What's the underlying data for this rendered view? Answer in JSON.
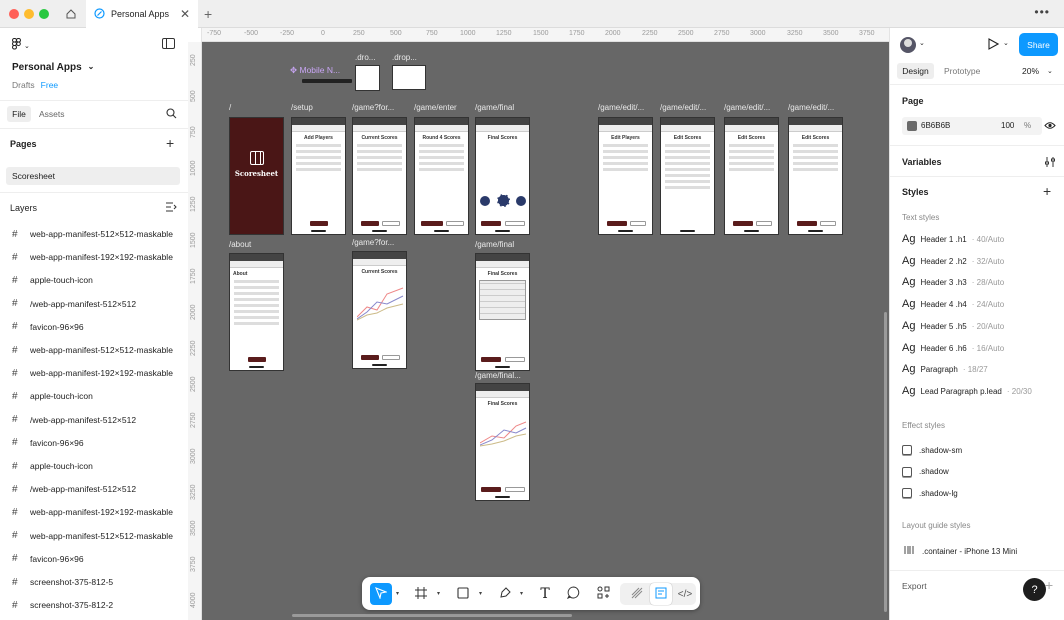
{
  "window": {
    "tab_title": "Personal Apps"
  },
  "file": {
    "name": "Personal Apps",
    "location": "Drafts",
    "plan": "Free",
    "tabs": [
      "File",
      "Assets"
    ]
  },
  "pages": {
    "title": "Pages",
    "items": [
      "Scoresheet"
    ]
  },
  "layers": {
    "title": "Layers",
    "items": [
      "web-app-manifest-512×512-maskable",
      "web-app-manifest-192×192-maskable",
      "apple-touch-icon",
      "/web-app-manifest-512×512",
      "favicon-96×96",
      "web-app-manifest-512×512-maskable",
      "web-app-manifest-192×192-maskable",
      "apple-touch-icon",
      "/web-app-manifest-512×512",
      "favicon-96×96",
      "apple-touch-icon",
      "/web-app-manifest-512×512",
      "web-app-manifest-192×192-maskable",
      "web-app-manifest-512×512-maskable",
      "favicon-96×96",
      "screenshot-375-812-5",
      "screenshot-375-812-2"
    ]
  },
  "rulers": {
    "h": [
      "-750",
      "-500",
      "-250",
      "0",
      "250",
      "500",
      "750",
      "1000",
      "1250",
      "1500",
      "1750",
      "2000",
      "2250",
      "2500",
      "2750",
      "3000",
      "3250",
      "3500",
      "3750"
    ],
    "v": [
      "250",
      "500",
      "750",
      "1000",
      "1250",
      "1500",
      "1750",
      "2000",
      "2250",
      "2500",
      "2750",
      "3000",
      "3250",
      "3500",
      "3750",
      "4000"
    ]
  },
  "canvas": {
    "labels": {
      "mobile": "Mobile N...",
      "drop1": ".dro...",
      "drop2": ".drop...",
      "root": "/",
      "setup": "/setup",
      "gamefor": "/game?for...",
      "gameenter": "/game/enter",
      "gamefinal": "/game/final",
      "edit1": "/game/edit/...",
      "edit2": "/game/edit/...",
      "edit3": "/game/edit/...",
      "edit4": "/game/edit/...",
      "about": "/about",
      "gamefor2": "/game?for...",
      "gamefinal2": "/game/final",
      "gamefinal3": "/game/final..."
    },
    "frames": {
      "splash": "Scoresheet",
      "add_players": "Add Players",
      "current_scores": "Current Scores",
      "round_scores": "Round 4 Scores",
      "final_scores": "Final Scores",
      "edit_players": "Edit Players",
      "edit_scores": "Edit Scores",
      "about": "About"
    }
  },
  "inspector": {
    "tabs": [
      "Design",
      "Prototype"
    ],
    "zoom": "20%",
    "share": "Share",
    "page": {
      "title": "Page",
      "color_hex": "6B6B6B",
      "opacity": "100",
      "percent": "%",
      "swatch": "#6b6b6b"
    },
    "variables": "Variables",
    "styles": "Styles",
    "text_styles_title": "Text styles",
    "text_styles": [
      {
        "ag": "Ag",
        "name": "Header 1 .h1",
        "meta": "· 40/Auto"
      },
      {
        "ag": "Ag",
        "name": "Header 2 .h2",
        "meta": "· 32/Auto"
      },
      {
        "ag": "Ag",
        "name": "Header 3 .h3",
        "meta": "· 28/Auto"
      },
      {
        "ag": "Ag",
        "name": "Header 4 .h4",
        "meta": "· 24/Auto"
      },
      {
        "ag": "Ag",
        "name": "Header 5 .h5",
        "meta": "· 20/Auto"
      },
      {
        "ag": "Ag",
        "name": "Header 6 .h6",
        "meta": "· 16/Auto"
      },
      {
        "ag": "Ag",
        "name": "Paragraph",
        "meta": "· 18/27"
      },
      {
        "ag": "Ag",
        "name": "Lead Paragraph p.lead",
        "meta": "· 20/30"
      }
    ],
    "effect_styles_title": "Effect styles",
    "effect_styles": [
      ".shadow-sm",
      ".shadow",
      ".shadow-lg"
    ],
    "layout_styles_title": "Layout guide styles",
    "layout_styles": [
      ".container - iPhone 13 Mini"
    ],
    "export": "Export",
    "help": "?"
  },
  "colors": {
    "canvas": "#676767",
    "accent": "#0d99ff",
    "brand_dark": "#4a1616",
    "mobile_label": "#c9a6f5"
  }
}
